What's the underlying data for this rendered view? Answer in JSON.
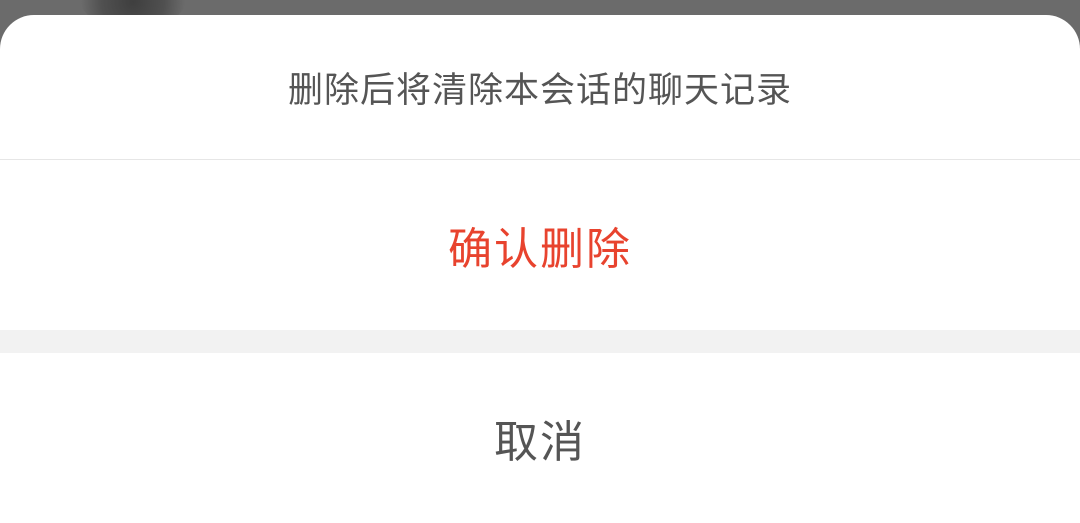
{
  "action_sheet": {
    "message": "删除后将清除本会话的聊天记录",
    "confirm_label": "确认删除",
    "cancel_label": "取消"
  },
  "colors": {
    "overlay": "#6b6b6b",
    "sheet_background": "#ffffff",
    "destructive": "#e8432e",
    "neutral_text": "#555555",
    "divider_gap": "#f2f2f2"
  }
}
